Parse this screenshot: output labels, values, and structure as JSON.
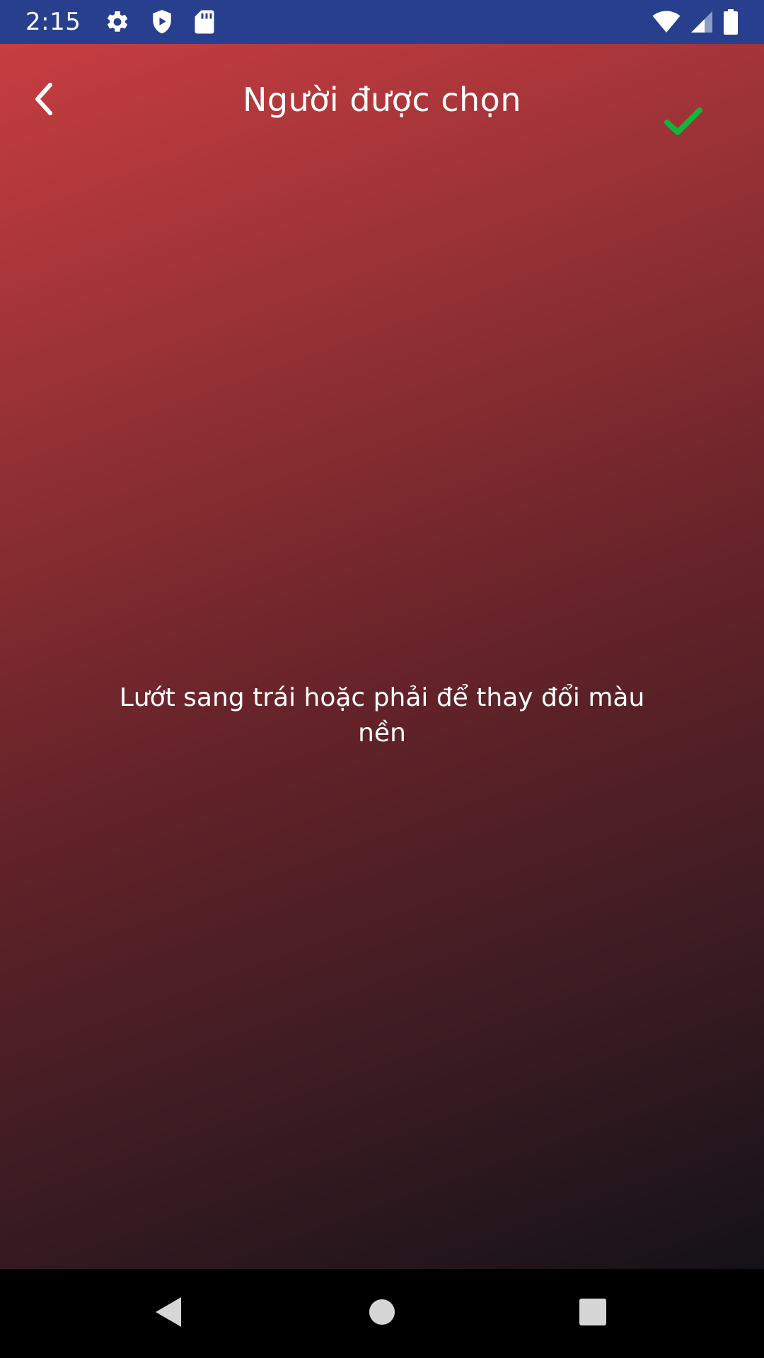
{
  "status_bar": {
    "time": "2:15",
    "background": "#283f8d",
    "left_icons": [
      "settings-icon",
      "shield-play-icon",
      "sd-card-icon"
    ],
    "right_icons": [
      "wifi-icon",
      "signal-icon",
      "battery-icon"
    ]
  },
  "header": {
    "title": "Người được chọn",
    "back_icon": "chevron-left-icon",
    "confirm_icon": "checkmark-icon",
    "confirm_color": "#16b33b"
  },
  "main": {
    "hint": "Lướt sang trái hoặc phải để thay đổi màu nền",
    "gradient_colors": [
      "#c73d41",
      "#652329",
      "#141217"
    ]
  },
  "nav_bar": {
    "icons": [
      "back-triangle-icon",
      "home-circle-icon",
      "recents-square-icon"
    ]
  }
}
